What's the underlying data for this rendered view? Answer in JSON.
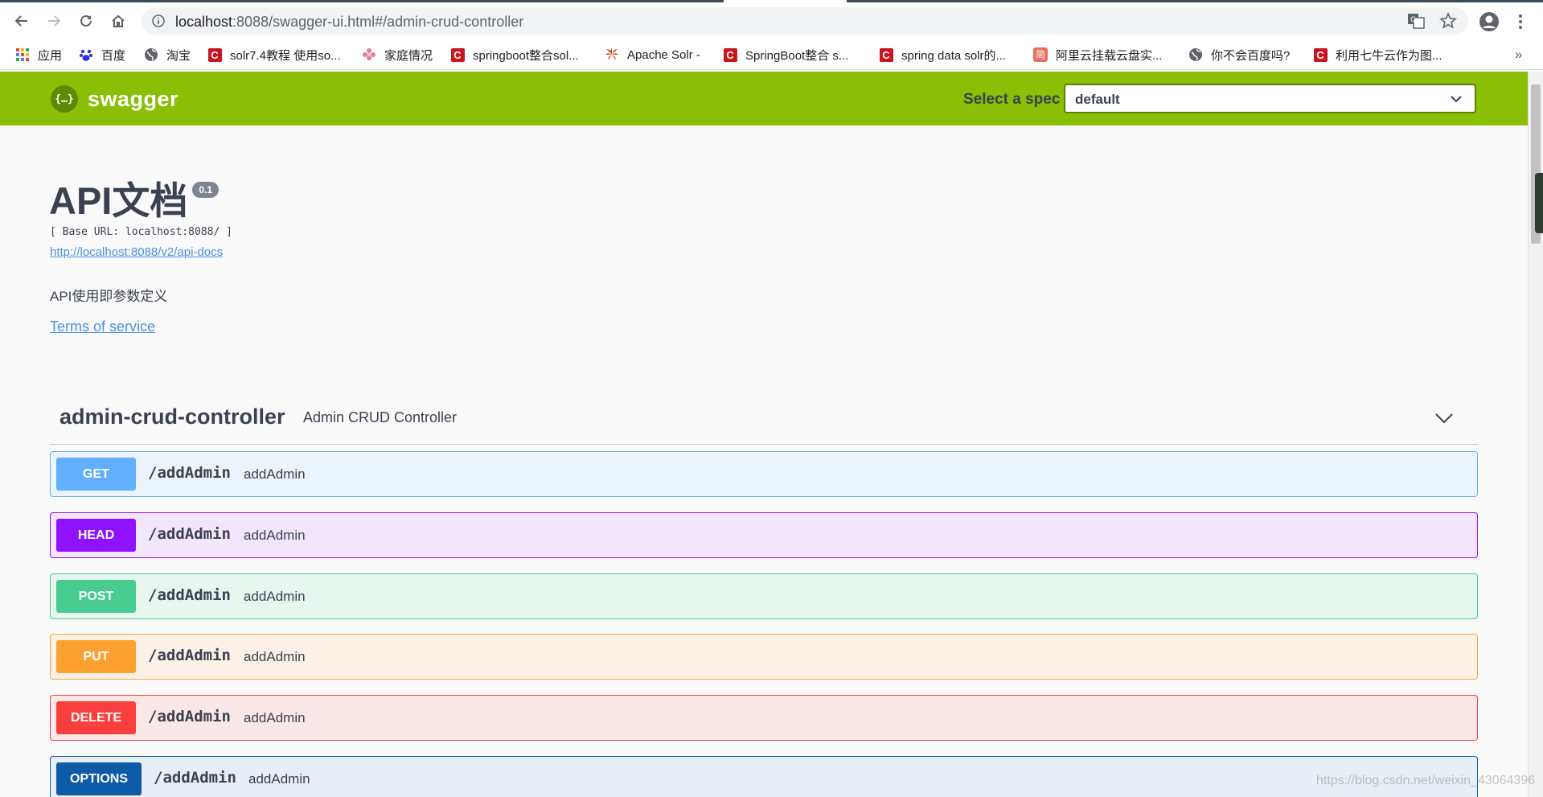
{
  "browser": {
    "url_host": "localhost",
    "url_path": ":8088/swagger-ui.html#/admin-crud-controller",
    "bookmarks": [
      {
        "label": "应用",
        "icon": "apps-grid-icon"
      },
      {
        "label": "百度",
        "icon": "baidu-paw-icon"
      },
      {
        "label": "淘宝",
        "icon": "globe-icon"
      },
      {
        "label": "solr7.4教程 使用so...",
        "icon": "csdn-icon"
      },
      {
        "label": "家庭情况",
        "icon": "flower-icon"
      },
      {
        "label": "springboot整合sol...",
        "icon": "csdn-icon"
      },
      {
        "label": "Apache Solr -",
        "icon": "solr-icon"
      },
      {
        "label": "SpringBoot整合 s...",
        "icon": "csdn-icon"
      },
      {
        "label": "spring data solr的...",
        "icon": "csdn-icon"
      },
      {
        "label": "阿里云挂载云盘实...",
        "icon": "jianshu-icon"
      },
      {
        "label": "你不会百度吗?",
        "icon": "globe-icon"
      },
      {
        "label": "利用七牛云作为图...",
        "icon": "csdn-icon"
      }
    ],
    "bookmarks_more": "»",
    "csdn_glyph": "C",
    "jianshu_glyph": "简"
  },
  "swagger": {
    "logo_text": "swagger",
    "logo_glyph": "{…}",
    "spec_label": "Select a spec",
    "spec_value": "default",
    "brand_color": "#89bf04"
  },
  "info": {
    "title": "API文档",
    "version": "0.1",
    "base_url": "[ Base URL: localhost:8088/ ]",
    "api_docs_link": "http://localhost:8088/v2/api-docs",
    "description": "API使用即参数定义",
    "terms": "Terms of service"
  },
  "tag": {
    "name": "admin-crud-controller",
    "description": "Admin CRUD Controller"
  },
  "operations": [
    {
      "method": "GET",
      "path": "/addAdmin",
      "summary": "addAdmin",
      "color": "#61affe"
    },
    {
      "method": "HEAD",
      "path": "/addAdmin",
      "summary": "addAdmin",
      "color": "#9012fe"
    },
    {
      "method": "POST",
      "path": "/addAdmin",
      "summary": "addAdmin",
      "color": "#49cc90"
    },
    {
      "method": "PUT",
      "path": "/addAdmin",
      "summary": "addAdmin",
      "color": "#fca130"
    },
    {
      "method": "DELETE",
      "path": "/addAdmin",
      "summary": "addAdmin",
      "color": "#f93e3e"
    },
    {
      "method": "OPTIONS",
      "path": "/addAdmin",
      "summary": "addAdmin",
      "color": "#0d5aa7"
    }
  ],
  "watermark": "https://blog.csdn.net/weixin_43064396"
}
